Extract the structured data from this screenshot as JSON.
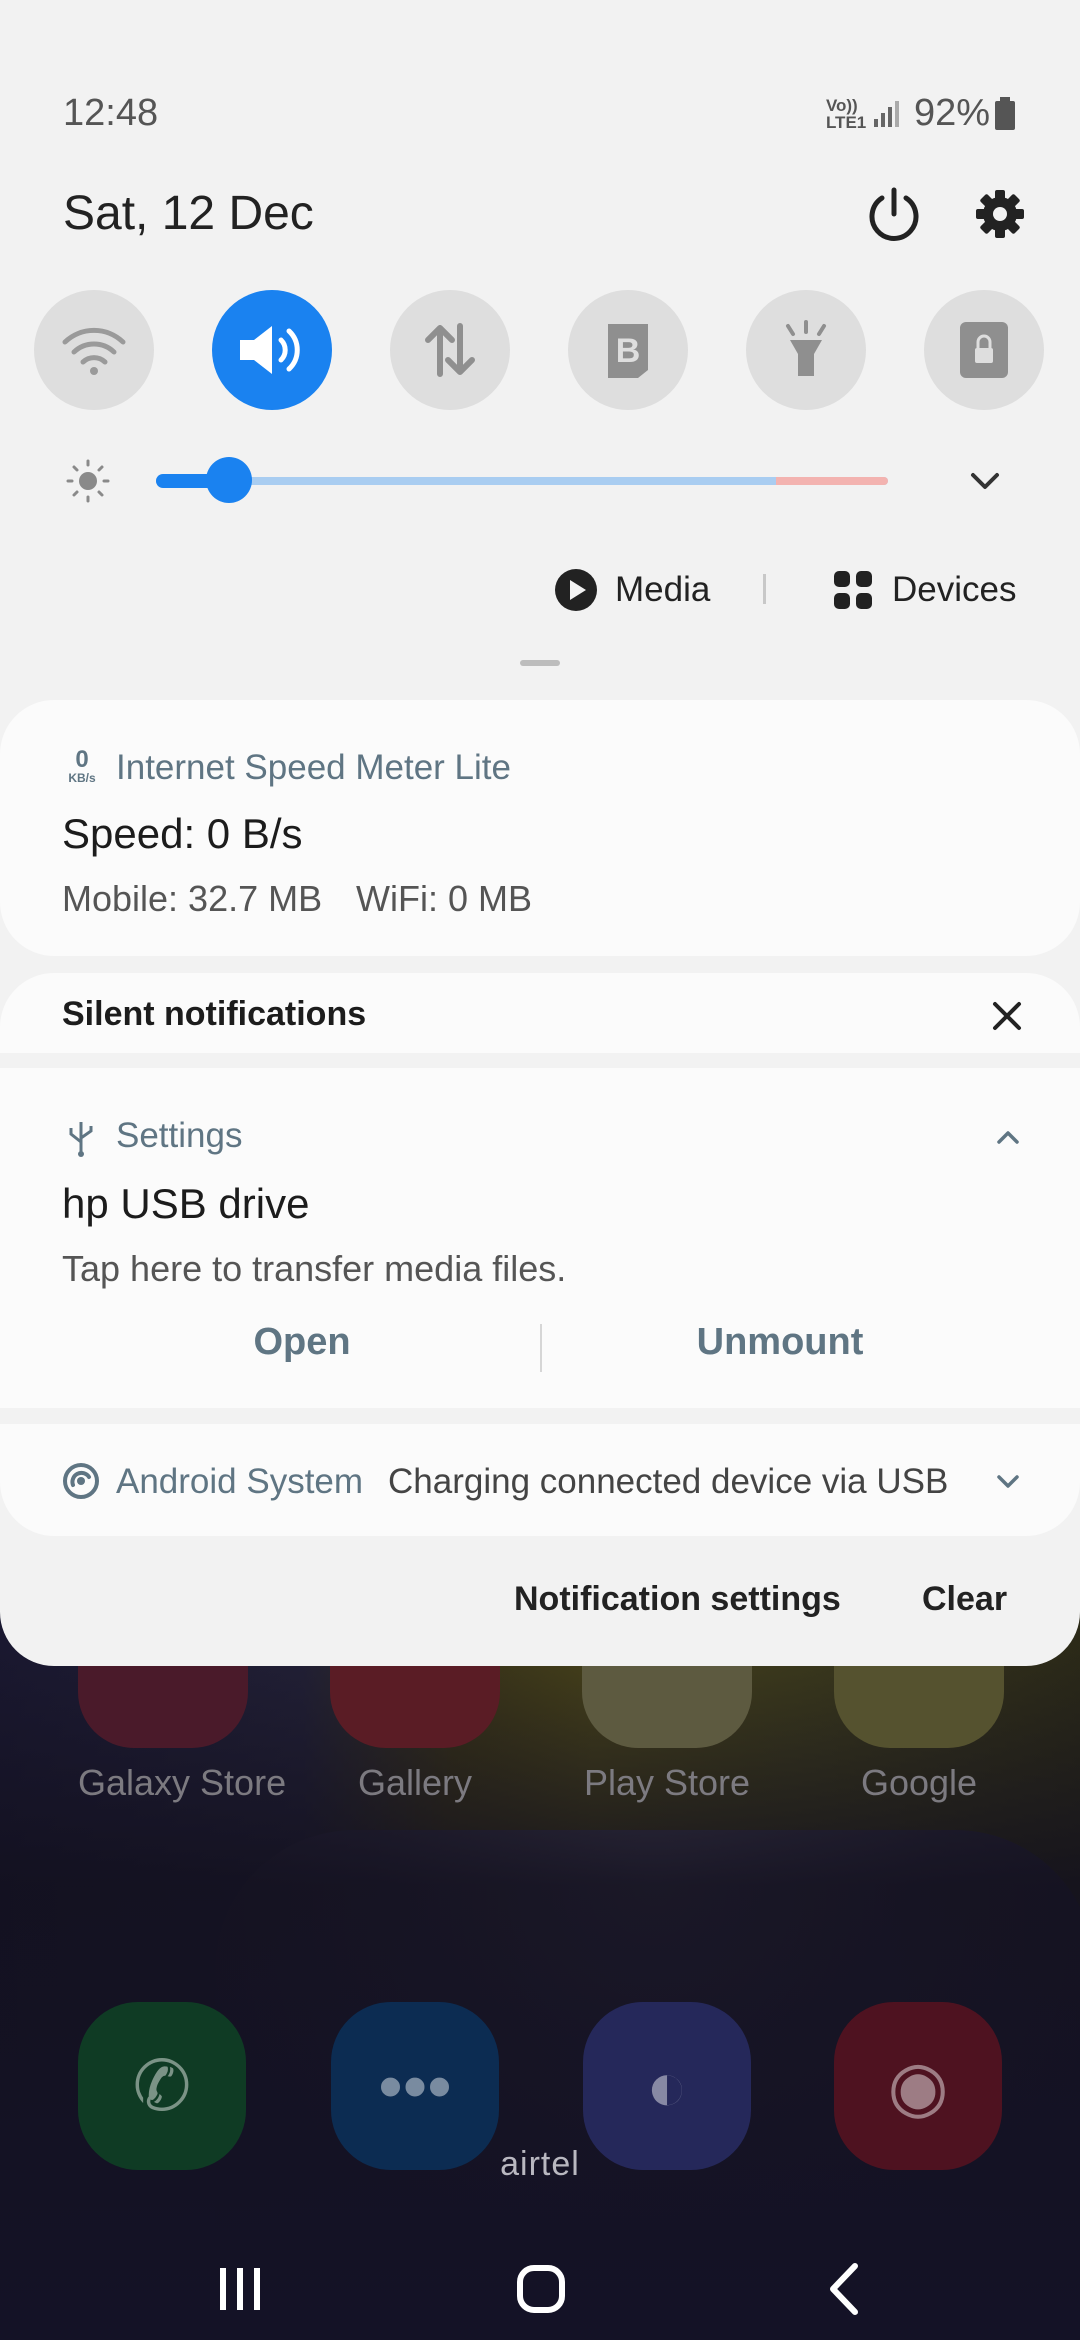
{
  "status": {
    "time": "12:48",
    "network_label": "Vo)) LTE1",
    "battery": "92%"
  },
  "header": {
    "date": "Sat, 12 Dec"
  },
  "quick_settings": {
    "tiles": [
      {
        "name": "wifi-icon",
        "active": false
      },
      {
        "name": "sound-icon",
        "active": true
      },
      {
        "name": "mobile-data-icon",
        "active": false
      },
      {
        "name": "bluetooth-icon",
        "active": false
      },
      {
        "name": "flashlight-icon",
        "active": false
      },
      {
        "name": "screen-lock-icon",
        "active": false
      }
    ],
    "brightness_level": 0.1
  },
  "media_label": "Media",
  "devices_label": "Devices",
  "speed_meter": {
    "badge_value": "0",
    "badge_unit": "KB/s",
    "app": "Internet Speed Meter Lite",
    "title": "Speed: 0 B/s",
    "mobile": "Mobile: 32.7 MB",
    "wifi": "WiFi: 0 MB"
  },
  "silent": {
    "label": "Silent notifications"
  },
  "usb": {
    "app": "Settings",
    "title": "hp USB drive",
    "body": "Tap here to transfer media files.",
    "open_label": "Open",
    "unmount_label": "Unmount"
  },
  "android_system": {
    "app": "Android System",
    "text": "Charging connected device via USB"
  },
  "footer": {
    "settings_label": "Notification settings",
    "clear_label": "Clear"
  },
  "home": {
    "apps": [
      "Galaxy Store",
      "Gallery",
      "Play Store",
      "Google"
    ],
    "carrier": "airtel"
  },
  "colors": {
    "accent": "#1a82f0",
    "muted_text": "#5f7583"
  }
}
